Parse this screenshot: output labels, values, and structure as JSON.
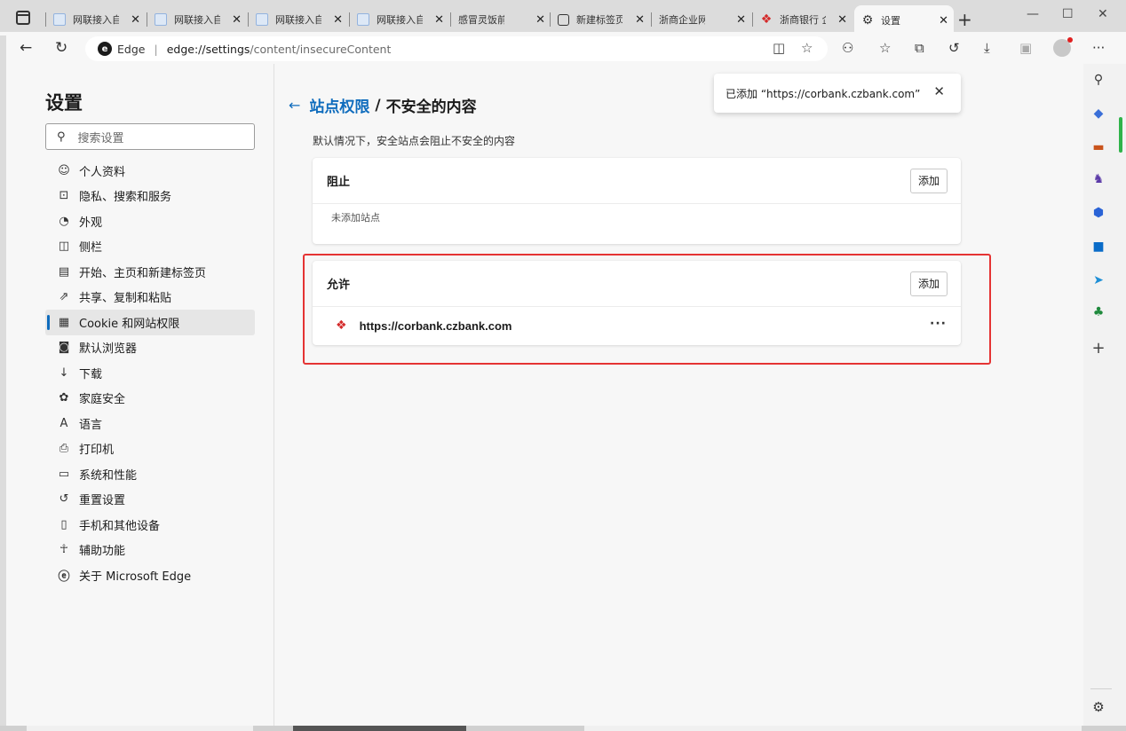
{
  "tabs": [
    {
      "label": "网联接入自",
      "icon": "document-icon"
    },
    {
      "label": "网联接入自",
      "icon": "document-icon"
    },
    {
      "label": "网联接入自",
      "icon": "document-icon"
    },
    {
      "label": "网联接入自",
      "icon": "document-icon"
    },
    {
      "label": "感冒灵饭前",
      "icon": "search-icon"
    },
    {
      "label": "新建标签页",
      "icon": "newtab-icon"
    },
    {
      "label": "浙商企业网",
      "icon": "search-icon"
    },
    {
      "label": "浙商银行 企",
      "icon": "bank-icon"
    },
    {
      "label": "设置",
      "icon": "gear-icon",
      "active": true
    }
  ],
  "address_bar": {
    "brand": "Edge",
    "url_host": "edge://settings",
    "url_path": "/content/insecureContent"
  },
  "sidebar": {
    "title": "设置",
    "search_placeholder": "搜索设置",
    "items": [
      {
        "label": "个人资料",
        "icon": "profile-icon"
      },
      {
        "label": "隐私、搜索和服务",
        "icon": "lock-icon"
      },
      {
        "label": "外观",
        "icon": "palette-icon"
      },
      {
        "label": "侧栏",
        "icon": "sidebar-icon"
      },
      {
        "label": "开始、主页和新建标签页",
        "icon": "home-icon"
      },
      {
        "label": "共享、复制和粘贴",
        "icon": "share-icon"
      },
      {
        "label": "Cookie 和网站权限",
        "icon": "cookie-icon",
        "selected": true
      },
      {
        "label": "默认浏览器",
        "icon": "browser-icon"
      },
      {
        "label": "下载",
        "icon": "download-icon"
      },
      {
        "label": "家庭安全",
        "icon": "family-icon"
      },
      {
        "label": "语言",
        "icon": "language-icon"
      },
      {
        "label": "打印机",
        "icon": "printer-icon"
      },
      {
        "label": "系统和性能",
        "icon": "laptop-icon"
      },
      {
        "label": "重置设置",
        "icon": "reset-icon"
      },
      {
        "label": "手机和其他设备",
        "icon": "phone-icon"
      },
      {
        "label": "辅助功能",
        "icon": "accessibility-icon"
      },
      {
        "label": "关于 Microsoft Edge",
        "icon": "edge-icon"
      }
    ]
  },
  "content": {
    "breadcrumb_link": "站点权限",
    "breadcrumb_separator": "/",
    "page_title": "不安全的内容",
    "description": "默认情况下，安全站点会阻止不安全的内容",
    "block_section": {
      "title": "阻止",
      "add_label": "添加",
      "empty_text": "未添加站点"
    },
    "allow_section": {
      "title": "允许",
      "add_label": "添加",
      "sites": [
        {
          "url": "https://corbank.czbank.com",
          "more_label": "···"
        }
      ]
    }
  },
  "toast": {
    "message": "已添加 “https://corbank.czbank.com”"
  },
  "colors": {
    "accent": "#0f6cbd",
    "highlight_border": "#e53434",
    "bank_red": "#d42b2b"
  }
}
